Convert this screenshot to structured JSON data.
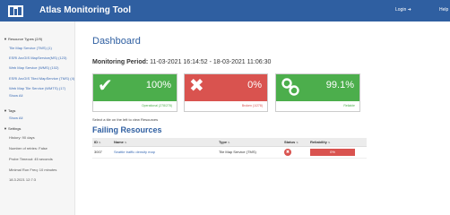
{
  "header": {
    "app_title": "Atlas Monitoring Tool",
    "login_label": "Login",
    "login_icon": "sign-in-icon",
    "help_label": "Help"
  },
  "sidebar": {
    "resource_types_heading": "Resource Types (2/9)",
    "resource_types": [
      "Tile Map Service (TMS) (1)",
      "ESRI ArcGIS MapService(MS) (123)",
      "Web Map Service (WMS) (102)",
      "ESRI ArcGIS Tiled MapService (TMS) (4)",
      "Web Map Tile Service (WMTS) (17)",
      "Show All"
    ],
    "tags_heading": "Tags",
    "tags": [
      "Show All"
    ],
    "settings_heading": "Settings",
    "settings": [
      "History: 90 days",
      "Number of retries: False",
      "Probe Timeout: 45 seconds",
      "Minimal Run Freq: 10 minutes",
      "18.3.2021 12:7:3"
    ]
  },
  "main": {
    "title": "Dashboard",
    "period_label": "Monitoring Period:",
    "period_value": "11-03-2021 16:14:52 - 18-03-2021 11:06:30",
    "tiles": [
      {
        "icon": "checkmark-icon",
        "value": "100%",
        "footer": "Operational (278/278)"
      },
      {
        "icon": "cross-icon",
        "value": "0%",
        "footer": "Broken (1/278)"
      },
      {
        "icon": "link-icon",
        "value": "99.1%",
        "footer": "Reliable"
      }
    ],
    "hint": "Select a tile on the left to view Resources",
    "failing_title": "Failing Resources",
    "table": {
      "columns": [
        "ID",
        "Name",
        "Type",
        "Status",
        "Reliability"
      ],
      "rows": [
        {
          "id": "3007",
          "name": "Seattle traffic density map",
          "type": "Tile Map Service (TMS)",
          "status": "failed",
          "reliability": "0%"
        }
      ]
    }
  },
  "colors": {
    "header_blue": "#2f5fa1",
    "success_green": "#4cae4c",
    "danger_red": "#d9534f"
  }
}
